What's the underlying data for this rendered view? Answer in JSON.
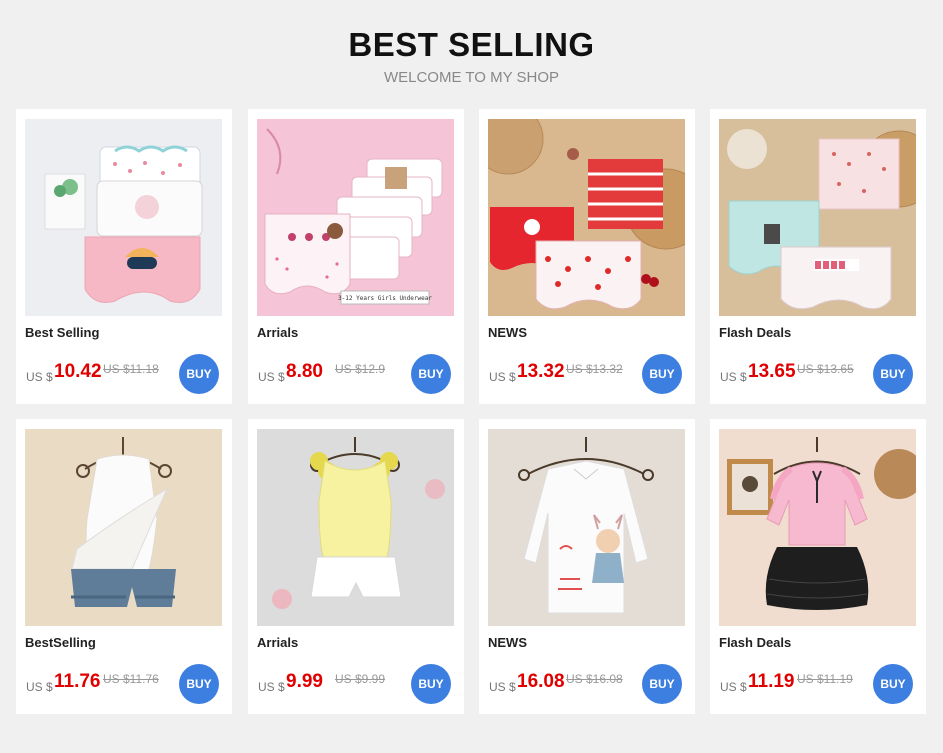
{
  "header": {
    "title": "BEST SELLING",
    "subtitle": "WELCOME TO MY SHOP"
  },
  "colors": {
    "price": "#e00000",
    "buy_button": "#3d7fe0",
    "background": "#f0f0f0"
  },
  "products": [
    {
      "name": "Best Selling",
      "currency": "US $",
      "price": "10.42",
      "old_price": "US $11.18",
      "buy_label": "BUY",
      "image": "girls-underwear-pastel-set"
    },
    {
      "name": "Arrials",
      "currency": "US $",
      "price": "8.80",
      "old_price": "US $12.9",
      "buy_label": "BUY",
      "image": "girls-underwear-ballerina-pack",
      "image_caption": "3-12 Years Girls Underwear"
    },
    {
      "name": "NEWS",
      "currency": "US $",
      "price": "13.32",
      "old_price": "US $13.32",
      "buy_label": "BUY",
      "image": "red-striped-underwear-set"
    },
    {
      "name": "Flash Deals",
      "currency": "US $",
      "price": "13.65",
      "old_price": "US $13.65",
      "buy_label": "BUY",
      "image": "mint-pink-underwear-set"
    },
    {
      "name": "BestSelling",
      "currency": "US $",
      "price": "11.76",
      "old_price": "US $11.76",
      "buy_label": "BUY",
      "image": "white-ruffle-top-denim-shorts"
    },
    {
      "name": "Arrials",
      "currency": "US $",
      "price": "9.99",
      "old_price": "US $9.99",
      "buy_label": "BUY",
      "image": "yellow-flower-top-white-shorts"
    },
    {
      "name": "NEWS",
      "currency": "US $",
      "price": "16.08",
      "old_price": "US $16.08",
      "buy_label": "BUY",
      "image": "white-shirt-bunny-print"
    },
    {
      "name": "Flash Deals",
      "currency": "US $",
      "price": "11.19",
      "old_price": "US $11.19",
      "buy_label": "BUY",
      "image": "pink-blouse-black-tutu"
    }
  ]
}
